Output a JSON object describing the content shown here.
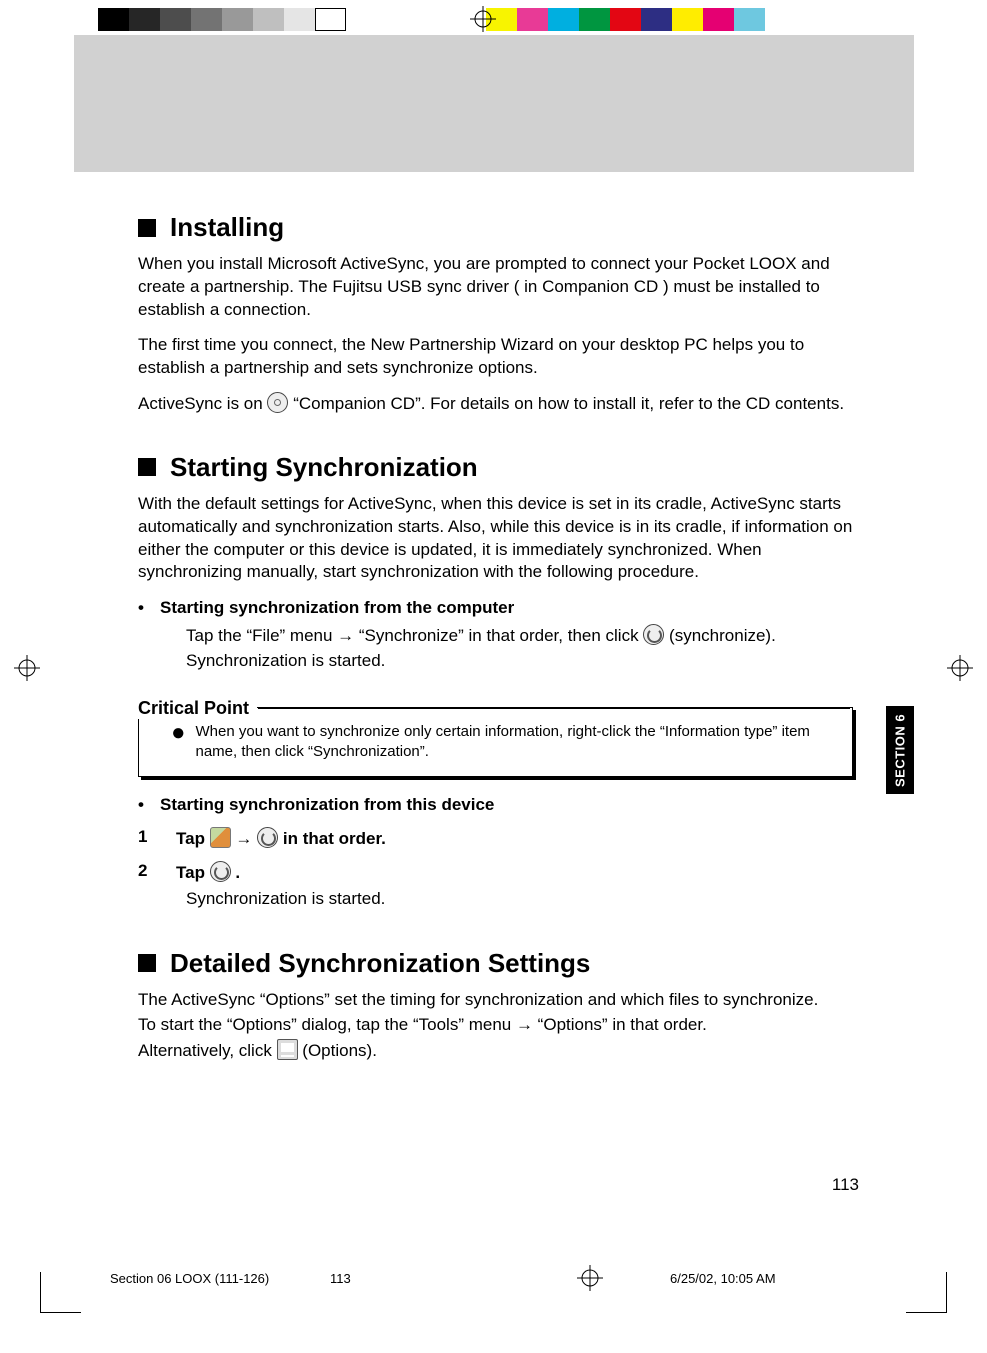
{
  "calib_colors": [
    "#000000",
    "#262626",
    "#4d4d4d",
    "#737373",
    "#999999",
    "#bfbfbf",
    "#e5e5e5",
    "#ffffff",
    "",
    "",
    "",
    "",
    "",
    "",
    "#f8f400",
    "#e83a96",
    "#00afe0",
    "#009640",
    "#e30613",
    "#2d2e83",
    "#ffed00",
    "#e6007e",
    "#009fe3"
  ],
  "heading1": "Installing",
  "h1_p1": "When you install Microsoft ActiveSync, you are prompted to connect your Pocket LOOX and create a partnership. The Fujitsu USB sync driver ( in Companion CD ) must be installed to establish a connection.",
  "h1_p2": "The first time you connect, the New Partnership Wizard on your desktop PC helps you to establish a partnership and sets synchronize options.",
  "h1_p3a": "ActiveSync is on ",
  "h1_p3b": " “Companion CD”. For details on how to install it, refer to the CD contents.",
  "heading2": "Starting Synchronization",
  "h2_p1": "With the default settings for ActiveSync, when this device is set in its cradle, ActiveSync starts automatically and synchronization starts. Also, while this device is in its cradle, if information on either the computer or this device is updated, it is immediately synchronized. When synchronizing manually, start synchronization with the following procedure.",
  "h2_b1": "Starting synchronization from the computer",
  "h2_b1_l1a": "Tap the “File” menu → “Synchronize” in that order, then click ",
  "h2_b1_l1b": " (synchronize).",
  "h2_b1_l2": "Synchronization is started.",
  "cp_label": "Critical Point",
  "cp_item1": "When you want to synchronize only certain information, right-click the “Information type” item name, then click “Synchronization”.",
  "h2_b2": "Starting synchronization from this device",
  "step1_num": "1",
  "step1a": "Tap ",
  "step1b": " → ",
  "step1c": " in that order.",
  "step2_num": "2",
  "step2a": "Tap ",
  "step2b": ".",
  "step2_body": "Synchronization is started.",
  "heading3": "Detailed Synchronization Settings",
  "h3_p1": "The ActiveSync “Options” set the timing for synchronization and which files to synchronize.",
  "h3_p2": "To start the “Options” dialog, tap the “Tools” menu → “Options” in that order.",
  "h3_p3a": "Alternatively, click ",
  "h3_p3b": " (Options).",
  "side_tab": "SECTION 6",
  "page_number": "113",
  "footer": {
    "file": "Section 06 LOOX (111-126)",
    "page": "113",
    "timestamp": "6/25/02, 10:05 AM"
  }
}
